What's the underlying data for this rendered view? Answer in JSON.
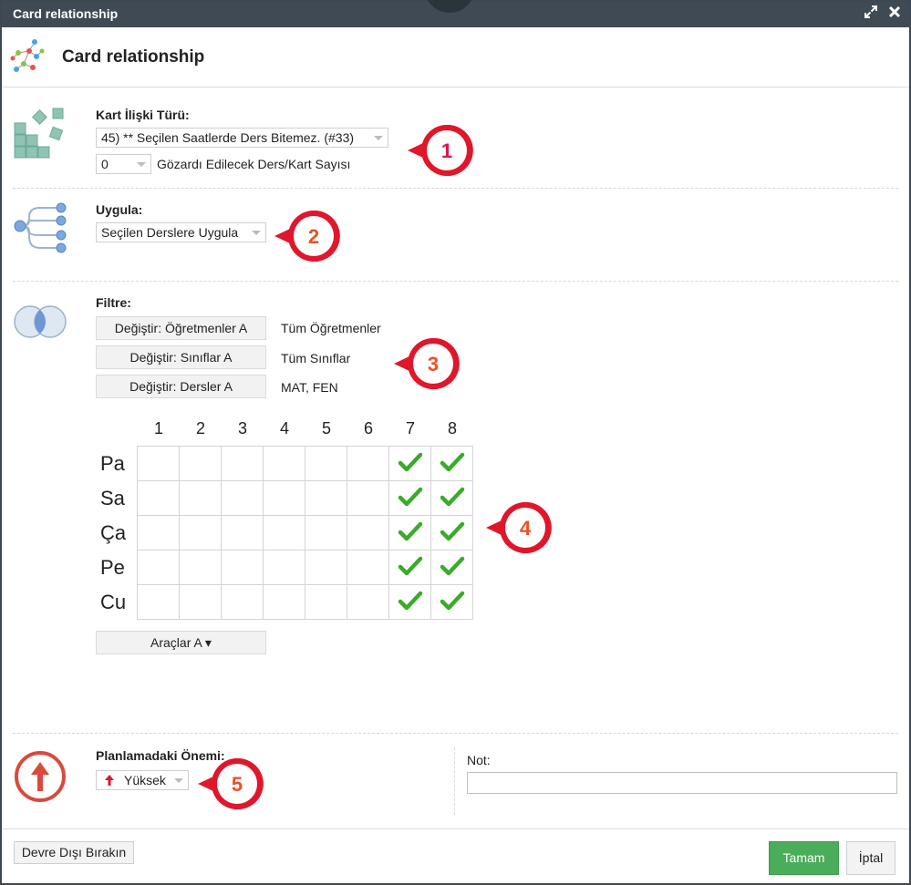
{
  "window": {
    "title": "Card relationship",
    "expand_icon": "expand-icon",
    "close_icon": "close-icon"
  },
  "header": {
    "title": "Card relationship",
    "icon": "network-icon"
  },
  "relationship": {
    "label": "Kart İlişki Türü:",
    "type_value": "45) ** Seçilen Saatlerde Ders Bitemez. (#33)",
    "ignore_count_value": "0",
    "ignore_count_label": "Gözardı Edilecek Ders/Kart Sayısı",
    "icon": "blocks-icon"
  },
  "apply": {
    "label": "Uygula:",
    "value": "Seçilen Derslere Uygula",
    "icon": "tree-icon"
  },
  "filter": {
    "label": "Filtre:",
    "icon": "venn-icon",
    "rows": [
      {
        "button": "Değiştir: Öğretmenler A",
        "value": "Tüm Öğretmenler"
      },
      {
        "button": "Değiştir: Sınıflar A",
        "value": "Tüm Sınıflar"
      },
      {
        "button": "Değiştir: Dersler A",
        "value": "MAT, FEN"
      }
    ]
  },
  "grid": {
    "columns": [
      "1",
      "2",
      "3",
      "4",
      "5",
      "6",
      "7",
      "8"
    ],
    "rows": [
      {
        "label": "Pa",
        "checked": [
          false,
          false,
          false,
          false,
          false,
          false,
          true,
          true
        ]
      },
      {
        "label": "Sa",
        "checked": [
          false,
          false,
          false,
          false,
          false,
          false,
          true,
          true
        ]
      },
      {
        "label": "Ça",
        "checked": [
          false,
          false,
          false,
          false,
          false,
          false,
          true,
          true
        ]
      },
      {
        "label": "Pe",
        "checked": [
          false,
          false,
          false,
          false,
          false,
          false,
          true,
          true
        ]
      },
      {
        "label": "Cu",
        "checked": [
          false,
          false,
          false,
          false,
          false,
          false,
          true,
          true
        ]
      }
    ],
    "tools_button": "Araçlar A ▾"
  },
  "importance": {
    "label": "Planlamadaki Önemi:",
    "value": "Yüksek",
    "icon": "arrow-up-circle-icon"
  },
  "note": {
    "label": "Not:",
    "value": ""
  },
  "markers": [
    "1",
    "2",
    "3",
    "4",
    "5"
  ],
  "footer": {
    "disable_button": "Devre Dışı Bırakın",
    "ok_button": "Tamam",
    "cancel_button": "İptal"
  },
  "colors": {
    "titlebar": "#3f4a54",
    "ok_green": "#4aad5a",
    "marker_red": "#e0162b",
    "marker_number": "#f04e23",
    "check_green": "#3aab2a"
  }
}
